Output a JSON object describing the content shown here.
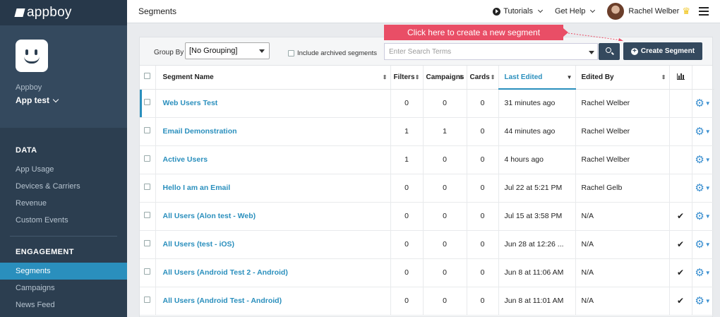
{
  "brand": {
    "name": "appboy"
  },
  "app": {
    "label": "Appboy",
    "name": "App test"
  },
  "nav": {
    "data_title": "DATA",
    "data_items": [
      "App Usage",
      "Devices & Carriers",
      "Revenue",
      "Custom Events"
    ],
    "engagement_title": "ENGAGEMENT",
    "engagement_items": [
      "Segments",
      "Campaigns",
      "News Feed"
    ],
    "active": "Segments"
  },
  "topbar": {
    "page_title": "Segments",
    "tutorials": "Tutorials",
    "help": "Get Help",
    "user": "Rachel Welber"
  },
  "toolbar": {
    "group_by_label": "Group By",
    "group_by_value": "[No Grouping]",
    "archived_label": "Include archived segments",
    "search_placeholder": "Enter Search Terms",
    "create_label": "Create Segment"
  },
  "tooltip": {
    "text": "Click here to create a new segment"
  },
  "table": {
    "headers": {
      "name": "Segment Name",
      "filters": "Filters",
      "campaigns": "Campaigns",
      "cards": "Cards",
      "last_edited": "Last Edited",
      "edited_by": "Edited By"
    },
    "rows": [
      {
        "name": "Web Users Test",
        "filters": "0",
        "campaigns": "0",
        "cards": "0",
        "last_edited": "31 minutes ago",
        "edited_by": "Rachel Welber",
        "checked": false
      },
      {
        "name": "Email Demonstration",
        "filters": "1",
        "campaigns": "1",
        "cards": "0",
        "last_edited": "44 minutes ago",
        "edited_by": "Rachel Welber",
        "checked": false
      },
      {
        "name": "Active Users",
        "filters": "1",
        "campaigns": "0",
        "cards": "0",
        "last_edited": "4 hours ago",
        "edited_by": "Rachel Welber",
        "checked": false
      },
      {
        "name": "Hello I am an Email",
        "filters": "0",
        "campaigns": "0",
        "cards": "0",
        "last_edited": "Jul 22 at 5:21 PM",
        "edited_by": "Rachel Gelb",
        "checked": false
      },
      {
        "name": "All Users (Alon test - Web)",
        "filters": "0",
        "campaigns": "0",
        "cards": "0",
        "last_edited": "Jul 15 at 3:58 PM",
        "edited_by": "N/A",
        "checked": true
      },
      {
        "name": "All Users (test - iOS)",
        "filters": "0",
        "campaigns": "0",
        "cards": "0",
        "last_edited": "Jun 28 at 12:26 ...",
        "edited_by": "N/A",
        "checked": true
      },
      {
        "name": "All Users (Android Test 2 - Android)",
        "filters": "0",
        "campaigns": "0",
        "cards": "0",
        "last_edited": "Jun 8 at 11:06 AM",
        "edited_by": "N/A",
        "checked": true
      },
      {
        "name": "All Users (Android Test - Android)",
        "filters": "0",
        "campaigns": "0",
        "cards": "0",
        "last_edited": "Jun 8 at 11:01 AM",
        "edited_by": "N/A",
        "checked": true
      }
    ]
  },
  "colors": {
    "sidebar": "#2c3e50",
    "accent": "#2a8fbd",
    "tooltip": "#e94e66",
    "button": "#34495e"
  }
}
